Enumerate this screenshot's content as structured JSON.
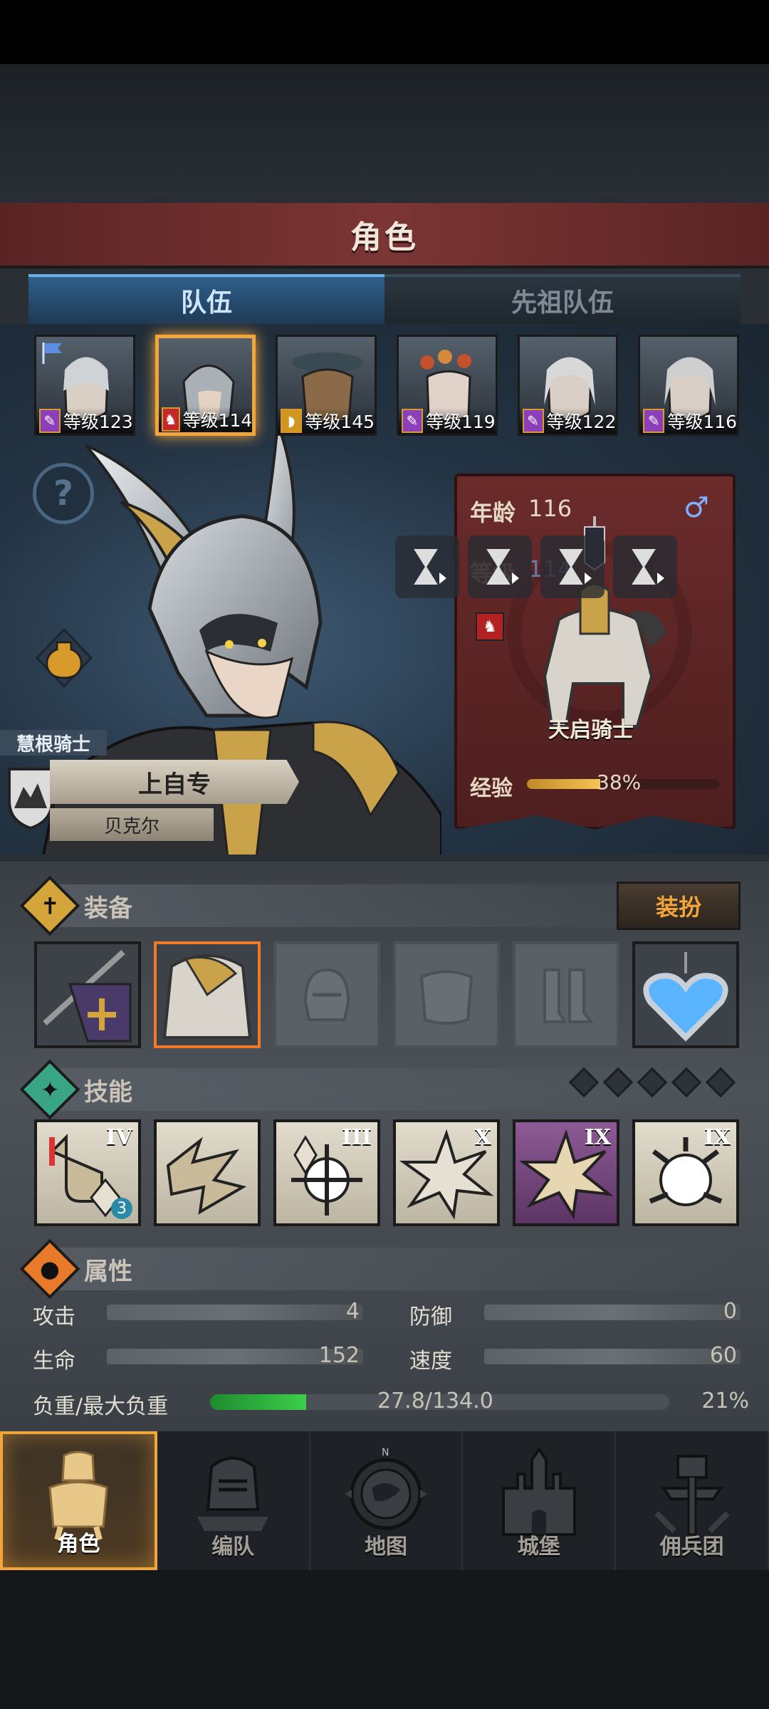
{
  "header": {
    "title": "角色"
  },
  "tabs": [
    {
      "label": "队伍",
      "active": true
    },
    {
      "label": "先祖队伍",
      "active": false
    }
  ],
  "roster": [
    {
      "level_text": "等级123",
      "class_color": "#8b3fb8",
      "selected": false,
      "flag": true
    },
    {
      "level_text": "等级114",
      "class_color": "#c22a2a",
      "selected": true,
      "flag": false
    },
    {
      "level_text": "等级145",
      "class_color": "#d19622",
      "selected": false,
      "flag": false
    },
    {
      "level_text": "等级119",
      "class_color": "#8b3fb8",
      "selected": false,
      "flag": false
    },
    {
      "level_text": "等级122",
      "class_color": "#8b3fb8",
      "selected": false,
      "flag": false
    },
    {
      "level_text": "等级116",
      "class_color": "#8b3fb8",
      "selected": false,
      "flag": false
    }
  ],
  "hero": {
    "class_tag": "慧根骑士",
    "name": "上自专",
    "surname": "贝克尔",
    "age_label": "年龄",
    "age": "116",
    "gender_icon": "♂",
    "level_label": "等级",
    "level": "114",
    "class_name": "天启骑士",
    "exp_label": "经验",
    "exp_percent_text": "38%",
    "exp_fraction": 0.38
  },
  "equipment": {
    "title": "装备",
    "dress_button": "装扮",
    "slots": [
      {
        "icon": "banner-weapon-icon",
        "empty": false,
        "selected": false
      },
      {
        "icon": "golden-armor-icon",
        "empty": false,
        "selected": true
      },
      {
        "icon": "helmet-slot-icon",
        "empty": true,
        "selected": false
      },
      {
        "icon": "chest-slot-icon",
        "empty": true,
        "selected": false
      },
      {
        "icon": "boots-slot-icon",
        "empty": true,
        "selected": false
      },
      {
        "icon": "heart-amulet-icon",
        "empty": false,
        "selected": false
      }
    ]
  },
  "skills": {
    "title": "技能",
    "items": [
      {
        "rank": "IV",
        "badge": "3",
        "purple": false
      },
      {
        "rank": "",
        "badge": "",
        "purple": false
      },
      {
        "rank": "III",
        "badge": "",
        "purple": false
      },
      {
        "rank": "X",
        "badge": "",
        "purple": false
      },
      {
        "rank": "IX",
        "badge": "",
        "purple": true
      },
      {
        "rank": "IX",
        "badge": "",
        "purple": false
      }
    ]
  },
  "attributes": {
    "title": "属性",
    "attack_label": "攻击",
    "attack": "4",
    "defense_label": "防御",
    "defense": "0",
    "hp_label": "生命",
    "hp": "152",
    "speed_label": "速度",
    "speed": "60",
    "load_label": "负重/最大负重",
    "load": "27.8/134.0",
    "load_pct": "21%",
    "load_fraction": 0.21
  },
  "nav": [
    {
      "label": "角色",
      "icon": "knight-icon",
      "active": true
    },
    {
      "label": "编队",
      "icon": "helmet-icon",
      "active": false
    },
    {
      "label": "地图",
      "icon": "compass-icon",
      "active": false
    },
    {
      "label": "城堡",
      "icon": "castle-icon",
      "active": false
    },
    {
      "label": "佣兵团",
      "icon": "mercenary-icon",
      "active": false
    }
  ]
}
